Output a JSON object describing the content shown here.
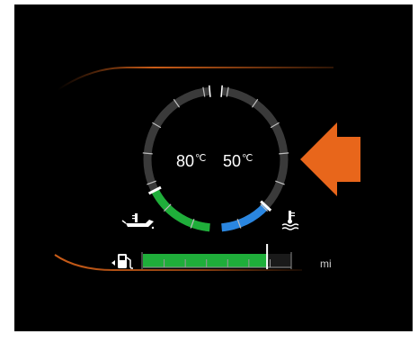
{
  "gauges": {
    "oil_temp": {
      "value": "80",
      "unit": "℃",
      "level": 0.62,
      "color": "#1fae3a",
      "icon": "oil-can-thermometer-icon"
    },
    "coolant_temp": {
      "value": "50",
      "unit": "℃",
      "level": 0.45,
      "color": "#2a86e0",
      "icon": "coolant-thermometer-icon"
    }
  },
  "fuel": {
    "level": 0.93,
    "segments": 7,
    "unit_label": "mi",
    "icon": "fuel-pump-icon",
    "color": "#1fae3a"
  },
  "pointer": {
    "icon": "arrow-left-icon",
    "color": "#e8661b"
  },
  "colors": {
    "panel_bg": "#000000",
    "accent_line": "#e0661a",
    "track": "#3a3a3a"
  }
}
